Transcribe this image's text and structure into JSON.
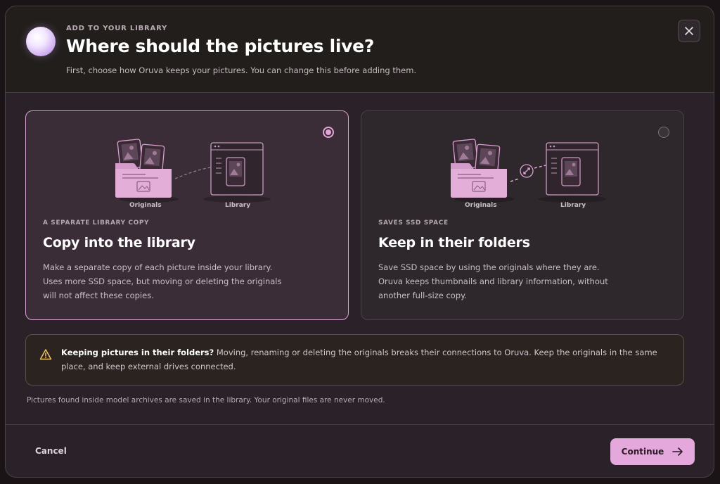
{
  "dialog": {
    "eyebrow": "ADD TO YOUR LIBRARY",
    "title": "Where should the pictures live?",
    "subtitle": "First, choose how Oruva keeps your pictures. You can change this before adding them.",
    "close_icon": "close-icon"
  },
  "options": [
    {
      "selected": true,
      "eyebrow": "A SEPARATE LIBRARY COPY",
      "title": "Copy into the library",
      "description": "Make a separate copy of each picture inside your library. Uses more SSD space, but moving or deleting the originals will not affect these copies.",
      "label_originals": "Originals",
      "label_library": "Library"
    },
    {
      "selected": false,
      "eyebrow": "SAVES SSD SPACE",
      "title": "Keep in their folders",
      "description": "Save SSD space by using the originals where they are. Oruva keeps thumbnails and library information, without another full-size copy.",
      "label_originals": "Originals",
      "label_library": "Library"
    }
  ],
  "warning": {
    "icon": "warning-triangle-icon",
    "bold": "Keeping pictures in their folders?",
    "text": " Moving, renaming or deleting the originals breaks their connections to Oruva. Keep the originals in the same place, and keep external drives connected."
  },
  "footnote": "Pictures found inside model archives are saved in the library. Your original files are never moved.",
  "footer": {
    "cancel": "Cancel",
    "continue": "Continue"
  },
  "colors": {
    "accent": "#e4a8dc",
    "selected_border": "#d9a0d0",
    "folder_fill": "#d49ccb"
  }
}
